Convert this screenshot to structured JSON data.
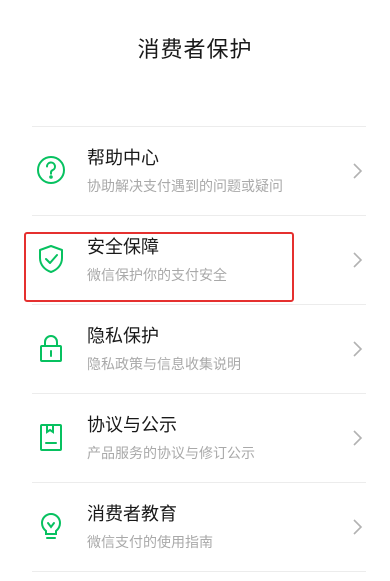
{
  "page": {
    "title": "消费者保护"
  },
  "colors": {
    "accent": "#07c160",
    "highlight_border": "#e5302f",
    "subtitle": "#a9a9a9",
    "separator": "#ececec"
  },
  "items": [
    {
      "icon": "question-icon",
      "title": "帮助中心",
      "subtitle": "协助解决支付遇到的问题或疑问"
    },
    {
      "icon": "shield-check-icon",
      "title": "安全保障",
      "subtitle": "微信保护你的支付安全"
    },
    {
      "icon": "lock-icon",
      "title": "隐私保护",
      "subtitle": "隐私政策与信息收集说明"
    },
    {
      "icon": "document-icon",
      "title": "协议与公示",
      "subtitle": "产品服务的协议与修订公示"
    },
    {
      "icon": "lightbulb-icon",
      "title": "消费者教育",
      "subtitle": "微信支付的使用指南"
    }
  ]
}
